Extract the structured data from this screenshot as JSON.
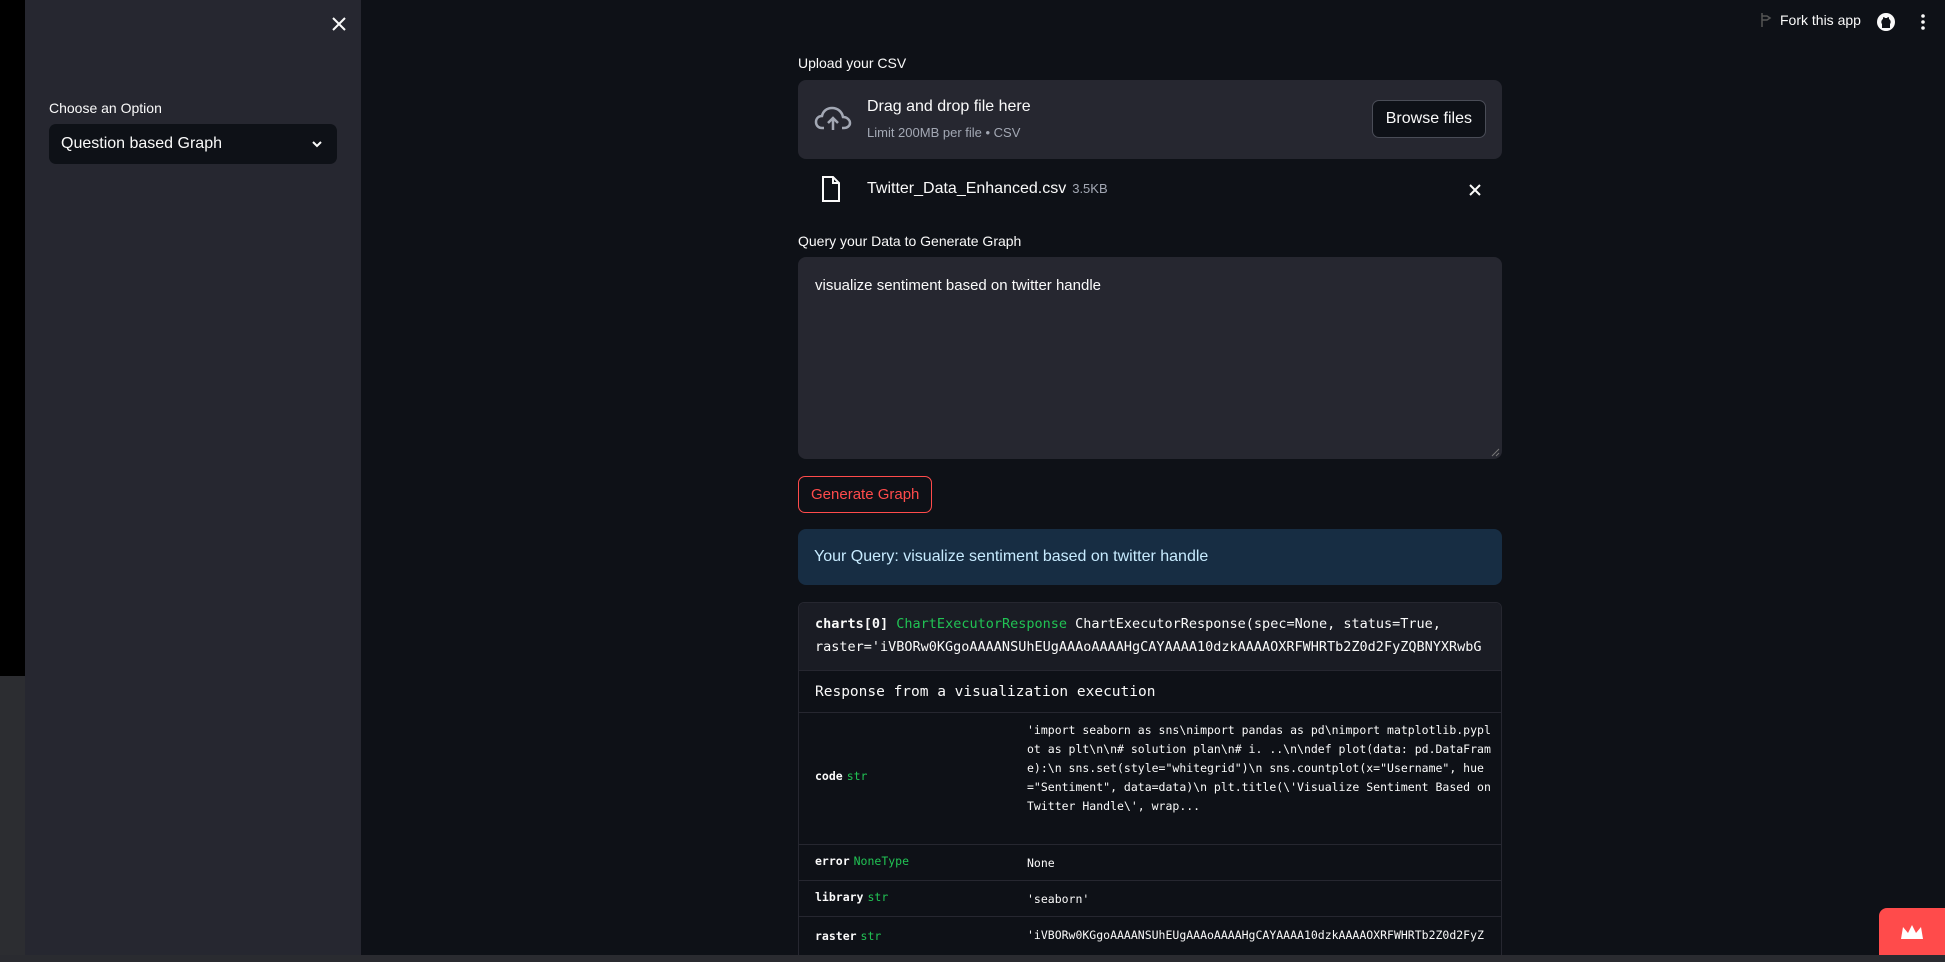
{
  "sidebar": {
    "option_label": "Choose an Option",
    "selected_option": "Question based Graph"
  },
  "topbar": {
    "fork_label": "Fork this app"
  },
  "upload": {
    "label": "Upload your CSV",
    "drop_title": "Drag and drop file here",
    "drop_limit": "Limit 200MB per file • CSV",
    "browse_label": "Browse files",
    "file_name": "Twitter_Data_Enhanced.csv",
    "file_size": "3.5KB"
  },
  "query": {
    "label": "Query your Data to Generate Graph",
    "value": "visualize sentiment based on twitter handle"
  },
  "generate_button": "Generate Graph",
  "info_message": "Your Query: visualize sentiment based on twitter handle",
  "inspect": {
    "var_name": "charts[0]",
    "type_name": "ChartExecutorResponse",
    "repr_line1": "ChartExecutorResponse(spec=None, status=True,",
    "repr_line2": "raster='iVBORw0KGgoAAAANSUhEUgAAAoAAAAHgCAYAAAA10dzkAAAAOXRFWHRTb2Z0d2FyZQBNYXRwbG",
    "docstring": "Response from a visualization execution",
    "rows": [
      {
        "key": "code",
        "type": "str",
        "value": "'import seaborn as sns\\nimport pandas as pd\\nimport matplotlib.pyplot as plt\\n\\n# solution plan\\n# i. ..\\n\\ndef plot(data: pd.DataFrame):\\n sns.set(style=\"whitegrid\")\\n sns.countplot(x=\"Username\", hue=\"Sentiment\", data=data)\\n plt.title(\\'Visualize Sentiment Based on Twitter Handle\\', wrap..."
      },
      {
        "key": "error",
        "type": "NoneType",
        "value": "None"
      },
      {
        "key": "library",
        "type": "str",
        "value": "'seaborn'"
      },
      {
        "key": "raster",
        "type": "str",
        "value": "'iVBORw0KGgoAAAANSUhEUgAAAoAAAAHgCAYAAAA10dzkAAAAOXRFWHRTb2Z0d2FyZ"
      }
    ]
  },
  "colors": {
    "background": "#0e1117",
    "sidebar": "#262730",
    "accent": "#ff4b4b",
    "info_bg": "#172d43",
    "type_green": "#21c354"
  }
}
